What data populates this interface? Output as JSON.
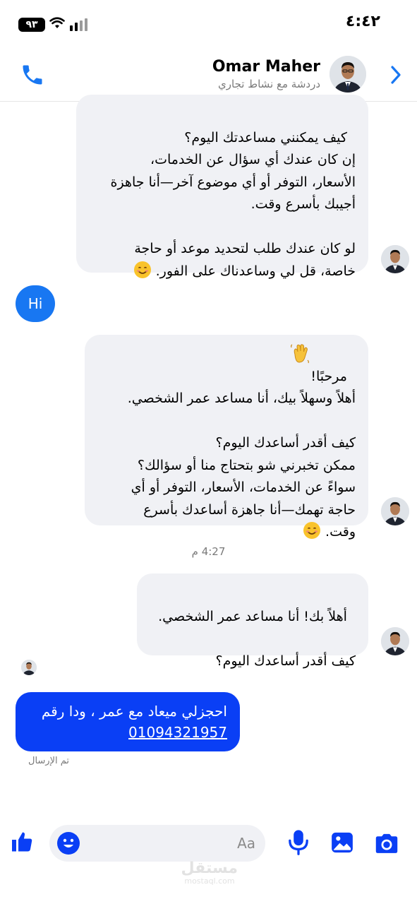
{
  "status_bar": {
    "time": "٤:٤٢",
    "battery": "٩٣"
  },
  "header": {
    "name": "Omar Maher",
    "subtitle": "دردشة مع نشاط تجاري"
  },
  "messages": {
    "m1_text": "كيف يمكنني مساعدتك اليوم؟\nإن كان عندك أي سؤال عن الخدمات،\nالأسعار، التوفر أو أي موضوع آخر—أنا جاهزة\nأجيبك بأسرع وقت.\n\nلو كان عندك طلب لتحديد موعد أو حاجة\nخاصة، قل لي وساعدناك على الفور. ",
    "hi_text": "Hi",
    "m2_text": "مرحبًا! \nأهلاً وسهلاً بيك، أنا مساعد عمر الشخصي.\n\nكيف أقدر أساعدك اليوم؟\nممكن تخبرني شو بتحتاج منا أو سؤالك؟\nسواءً عن الخدمات، الأسعار، التوفر أو أي\nحاجة تهمك—أنا جاهزة أساعدك بأسرع\nوقت. ",
    "time_separator": "4:27 م",
    "m3_text": "أهلاً بك! أنا مساعد عمر الشخصي.\n\nكيف أقدر أساعدك اليوم؟",
    "sent_line1": "احجزلي ميعاد مع عمر ، ودا رقم",
    "sent_phone": "01094321957",
    "sent_status": "تم الإرسال"
  },
  "composer": {
    "placeholder": "Aa"
  },
  "watermark": {
    "ar": "مستقل",
    "en": "mostaql.com"
  },
  "colors": {
    "accent": "#1877f2",
    "sent_bubble": "#0a3ff5",
    "received_bubble": "#f0f1f5"
  },
  "icons": [
    "wifi-icon",
    "signal-icon",
    "phone-call-icon",
    "chevron-right-icon",
    "thumbs-up-icon",
    "emoji-icon",
    "microphone-icon",
    "gallery-icon",
    "camera-icon"
  ]
}
